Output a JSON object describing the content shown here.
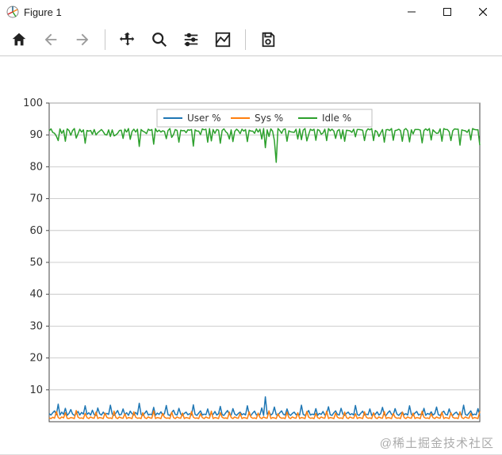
{
  "window": {
    "title": "Figure 1"
  },
  "watermark": "@稀土掘金技术社区",
  "toolbar": {
    "home": "Home",
    "back": "Back",
    "forward": "Forward",
    "pan": "Pan",
    "zoom": "Zoom",
    "subplots": "Configure subplots",
    "axes": "Edit axis",
    "save": "Save"
  },
  "chart_data": {
    "type": "line",
    "title": "",
    "xlabel": "",
    "ylabel": "",
    "xlim": [
      0,
      240
    ],
    "ylim": [
      0,
      100
    ],
    "yticks": [
      10,
      20,
      30,
      40,
      50,
      60,
      70,
      80,
      90,
      100
    ],
    "grid": true,
    "legend": {
      "position": "top-center"
    },
    "series": [
      {
        "name": "User %",
        "color": "#1f77b4",
        "values": [
          2.5,
          2.1,
          2.8,
          3.4,
          2.2,
          5.5,
          2.1,
          3.0,
          2.3,
          4.2,
          2.0,
          2.6,
          3.8,
          2.4,
          2.0,
          2.5,
          3.2,
          2.1,
          2.9,
          2.4,
          5.0,
          2.3,
          2.8,
          2.1,
          3.6,
          2.2,
          2.0,
          4.3,
          2.5,
          2.1,
          3.0,
          2.2,
          2.6,
          2.3,
          5.2,
          2.4,
          2.0,
          2.7,
          3.5,
          2.1,
          2.3,
          4.0,
          2.2,
          2.8,
          2.0,
          3.3,
          2.5,
          2.1,
          2.9,
          2.2,
          5.8,
          2.3,
          2.0,
          2.6,
          3.4,
          2.1,
          2.4,
          2.2,
          4.5,
          2.0,
          2.7,
          2.3,
          3.1,
          2.1,
          2.5,
          5.1,
          2.2,
          2.0,
          2.8,
          3.6,
          2.3,
          2.1,
          4.2,
          2.4,
          2.0,
          2.6,
          3.0,
          2.2,
          2.5,
          2.1,
          5.3,
          2.3,
          2.0,
          2.7,
          3.4,
          2.1,
          2.4,
          2.2,
          4.0,
          2.0,
          2.6,
          2.3,
          3.2,
          2.1,
          2.5,
          4.8,
          2.2,
          2.0,
          2.8,
          3.5,
          2.3,
          2.1,
          4.1,
          2.4,
          2.0,
          2.6,
          3.0,
          2.2,
          2.5,
          2.1,
          5.0,
          2.3,
          2.0,
          2.7,
          3.3,
          2.1,
          2.4,
          2.2,
          4.3,
          2.0,
          7.8,
          2.3,
          3.1,
          2.1,
          2.5,
          4.6,
          2.2,
          2.0,
          2.8,
          3.4,
          2.3,
          2.1,
          4.0,
          2.4,
          2.0,
          2.6,
          3.0,
          2.2,
          2.5,
          2.1,
          5.2,
          2.3,
          2.0,
          2.7,
          3.5,
          2.1,
          2.4,
          2.2,
          4.1,
          2.0,
          2.6,
          2.3,
          3.2,
          2.1,
          2.5,
          4.7,
          2.2,
          2.0,
          2.8,
          3.4,
          2.3,
          2.1,
          4.2,
          2.4,
          2.0,
          2.6,
          3.0,
          2.2,
          2.5,
          2.1,
          5.1,
          2.3,
          2.0,
          2.7,
          3.3,
          2.1,
          2.4,
          2.2,
          4.0,
          2.0,
          2.6,
          2.3,
          3.1,
          2.1,
          2.5,
          4.5,
          2.2,
          2.0,
          2.8,
          3.4,
          2.3,
          2.1,
          4.1,
          2.4,
          2.0,
          2.6,
          3.0,
          2.2,
          2.5,
          2.1,
          5.0,
          2.3,
          2.0,
          2.7,
          3.2,
          2.1,
          2.4,
          2.2,
          4.2,
          2.0,
          2.6,
          2.3,
          3.1,
          2.1,
          2.5,
          4.6,
          2.2,
          2.0,
          2.8,
          3.3,
          2.3,
          2.1,
          4.0,
          2.4,
          2.0,
          2.6,
          3.0,
          2.2,
          2.5,
          2.1,
          5.2,
          2.3,
          2.0,
          2.7,
          3.4,
          2.1,
          2.4,
          2.2,
          4.1,
          2.0
        ]
      },
      {
        "name": "Sys %",
        "color": "#ff7f0e",
        "values": [
          1.2,
          1.0,
          1.4,
          1.1,
          3.2,
          1.3,
          1.0,
          1.5,
          1.2,
          2.8,
          1.1,
          1.0,
          1.3,
          1.2,
          1.0,
          3.5,
          1.4,
          1.1,
          1.2,
          1.0,
          2.6,
          1.3,
          1.0,
          1.5,
          1.2,
          1.1,
          3.0,
          1.0,
          1.3,
          1.2,
          1.0,
          2.7,
          1.4,
          1.1,
          1.2,
          1.0,
          3.3,
          1.3,
          1.0,
          1.5,
          1.2,
          1.1,
          2.5,
          1.0,
          1.3,
          1.2,
          1.0,
          3.1,
          1.4,
          1.1,
          1.2,
          1.0,
          2.8,
          1.3,
          1.0,
          1.5,
          1.2,
          1.1,
          3.4,
          1.0,
          1.3,
          1.2,
          1.0,
          2.6,
          1.4,
          1.1,
          1.2,
          1.0,
          3.0,
          1.3,
          1.0,
          1.5,
          1.2,
          1.1,
          2.7,
          1.0,
          1.3,
          1.2,
          1.0,
          3.2,
          1.4,
          1.1,
          1.2,
          1.0,
          2.5,
          1.3,
          1.0,
          1.5,
          1.2,
          1.1,
          3.3,
          1.0,
          1.3,
          1.2,
          1.0,
          2.8,
          1.4,
          1.1,
          1.2,
          1.0,
          3.0,
          1.3,
          1.0,
          1.5,
          1.2,
          1.1,
          2.6,
          1.0,
          1.3,
          1.2,
          1.0,
          3.1,
          1.4,
          1.1,
          1.2,
          1.0,
          2.7,
          1.3,
          1.0,
          1.5,
          1.2,
          1.1,
          3.4,
          1.0,
          1.3,
          1.2,
          1.0,
          2.5,
          1.4,
          1.1,
          1.2,
          1.0,
          3.0,
          1.3,
          1.0,
          1.5,
          1.2,
          1.1,
          2.8,
          1.0,
          1.3,
          1.2,
          1.0,
          3.2,
          1.4,
          1.1,
          1.2,
          1.0,
          2.6,
          1.3,
          1.0,
          1.5,
          1.2,
          1.1,
          3.3,
          1.0,
          1.3,
          1.2,
          1.0,
          2.7,
          1.4,
          1.1,
          1.2,
          1.0,
          3.0,
          1.3,
          1.0,
          1.5,
          1.2,
          1.1,
          2.5,
          1.0,
          1.3,
          1.2,
          1.0,
          3.1,
          1.4,
          1.1,
          1.2,
          1.0,
          2.8,
          1.3,
          1.0,
          1.5,
          1.2,
          1.1,
          3.2,
          1.0,
          1.3,
          1.2,
          1.0,
          2.6,
          1.4,
          1.1,
          1.2,
          1.0,
          3.0,
          1.3,
          1.0,
          1.5,
          1.2,
          1.1,
          2.7,
          1.0,
          1.3,
          1.2,
          1.0,
          3.3,
          1.4,
          1.1,
          1.2,
          1.0,
          2.5,
          1.3,
          1.0,
          1.5,
          1.2,
          1.1,
          3.0,
          1.0,
          1.3,
          1.2,
          1.0,
          2.8,
          1.4,
          1.1,
          1.2,
          1.0,
          3.1,
          1.3,
          1.0,
          1.5,
          1.2,
          1.1,
          2.6,
          1.0,
          1.3,
          1.2,
          1.0,
          3.2
        ]
      },
      {
        "name": "Idle %",
        "color": "#2ca02c",
        "values": [
          91.3,
          91.9,
          90.8,
          90.5,
          89.6,
          88.2,
          91.9,
          90.5,
          91.5,
          88.0,
          91.9,
          91.4,
          89.9,
          91.4,
          92.0,
          89.0,
          90.4,
          91.8,
          90.9,
          91.6,
          87.4,
          91.4,
          91.2,
          91.4,
          90.2,
          91.7,
          90.0,
          90.7,
          91.2,
          91.7,
          91.0,
          90.1,
          90.0,
          91.6,
          89.5,
          91.6,
          89.7,
          90.0,
          90.5,
          91.4,
          91.5,
          88.9,
          91.8,
          90.9,
          92.0,
          88.6,
          91.1,
          91.8,
          90.9,
          91.8,
          86.4,
          91.7,
          91.2,
          90.9,
          90.4,
          91.8,
          91.4,
          91.7,
          87.1,
          92.0,
          91.0,
          91.5,
          90.9,
          91.3,
          91.1,
          88.8,
          91.4,
          92.0,
          89.2,
          90.1,
          91.7,
          91.4,
          87.7,
          91.5,
          91.3,
          91.4,
          90.7,
          91.6,
          91.5,
          91.7,
          86.5,
          91.6,
          91.2,
          91.2,
          90.1,
          91.9,
          91.6,
          91.8,
          87.7,
          92.0,
          88.1,
          91.7,
          90.5,
          91.7,
          91.5,
          87.4,
          91.4,
          91.9,
          91.0,
          90.5,
          88.7,
          91.6,
          87.9,
          91.1,
          91.8,
          91.3,
          90.4,
          91.8,
          91.2,
          91.7,
          87.9,
          91.5,
          91.2,
          91.2,
          90.5,
          91.9,
          90.9,
          91.8,
          88.7,
          92.0,
          86.0,
          91.6,
          89.5,
          91.9,
          91.2,
          88.2,
          81.4,
          92.0,
          91.4,
          90.5,
          91.7,
          91.9,
          88.0,
          91.3,
          91.0,
          90.9,
          90.8,
          91.8,
          88.7,
          91.9,
          88.5,
          91.5,
          92.0,
          88.1,
          90.1,
          91.8,
          91.4,
          91.8,
          88.3,
          91.7,
          91.4,
          90.2,
          90.6,
          91.8,
          88.2,
          92.0,
          91.3,
          91.8,
          91.2,
          88.9,
          91.3,
          91.7,
          88.8,
          91.6,
          88.0,
          91.5,
          91.4,
          91.3,
          90.8,
          91.8,
          89.4,
          91.7,
          91.7,
          91.6,
          91.5,
          88.2,
          91.2,
          91.9,
          91.6,
          92.0,
          88.2,
          91.4,
          91.0,
          89.5,
          90.6,
          91.7,
          87.7,
          91.6,
          91.7,
          91.4,
          92.0,
          88.3,
          91.4,
          91.5,
          91.8,
          91.4,
          88.0,
          91.6,
          92.0,
          91.3,
          87.8,
          91.6,
          90.3,
          91.7,
          91.7,
          91.7,
          91.5,
          87.5,
          91.4,
          91.9,
          91.4,
          92.0,
          88.4,
          91.6,
          91.0,
          90.5,
          90.6,
          91.9,
          88.0,
          92.0,
          91.7,
          91.7,
          91.0,
          88.2,
          91.3,
          91.9,
          91.8,
          91.8,
          86.8,
          91.6,
          91.4,
          91.3,
          90.8,
          91.7,
          88.4,
          92.0,
          91.7,
          91.6,
          91.6,
          86.8
        ]
      }
    ]
  }
}
